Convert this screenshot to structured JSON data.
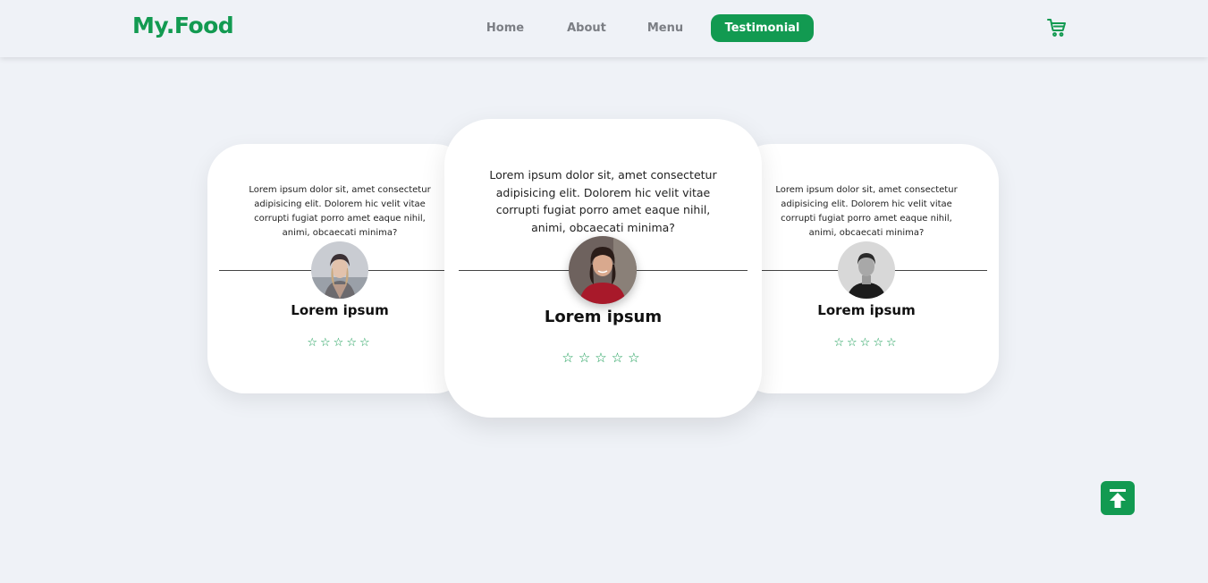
{
  "brand": {
    "logo": "My.Food",
    "accent": "#129a51"
  },
  "nav": {
    "items": [
      {
        "label": "Home"
      },
      {
        "label": "About"
      },
      {
        "label": "Menu"
      },
      {
        "label": "Testimonial",
        "active": true
      }
    ]
  },
  "header": {
    "cart_icon": "cart-icon"
  },
  "testimonials": [
    {
      "quote": "Lorem ipsum dolor sit, amet consectetur adipisicing elit. Dolorem hic velit vitae corrupti fugiat porro amet eaque nihil, animi, obcaecati minima?",
      "name": "Lorem ipsum",
      "stars": "☆☆☆☆☆",
      "rating_max": 5
    },
    {
      "quote": "Lorem ipsum dolor sit, amet consectetur adipisicing elit. Dolorem hic velit vitae corrupti fugiat porro amet eaque nihil, animi, obcaecati minima?",
      "name": "Lorem ipsum",
      "stars": "☆☆☆☆☆",
      "rating_max": 5
    },
    {
      "quote": "Lorem ipsum dolor sit, amet consectetur adipisicing elit. Dolorem hic velit vitae corrupti fugiat porro amet eaque nihil, animi, obcaecati minima?",
      "name": "Lorem ipsum",
      "stars": "☆☆☆☆☆",
      "rating_max": 5
    }
  ],
  "scroll_top": {
    "icon": "arrow-up-to-line-icon"
  }
}
